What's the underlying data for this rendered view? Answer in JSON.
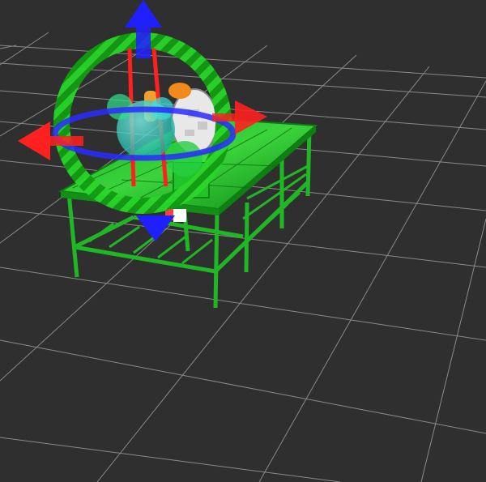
{
  "viewport": {
    "name": "3d-scene-view",
    "background": "#2f2f2f",
    "grid_color": "#9a9a9a"
  },
  "scene": {
    "table": {
      "name": "green-mesh-table",
      "color": "#22c22a"
    },
    "robot": {
      "name": "robot-model",
      "colors": [
        "#ffffff",
        "#f08a1c",
        "#ff2a2a"
      ]
    }
  },
  "gizmo": {
    "name": "interactive-marker-transform-gizmo",
    "rotation_ring_color": "#1fd61f",
    "x_axis_color": "#ff2020",
    "y_axis_color": "#2020ff",
    "z_axis_color": "#2020ff",
    "yaw_ring_color": "#2a2aff",
    "sphere_color": "#27e0d0"
  }
}
